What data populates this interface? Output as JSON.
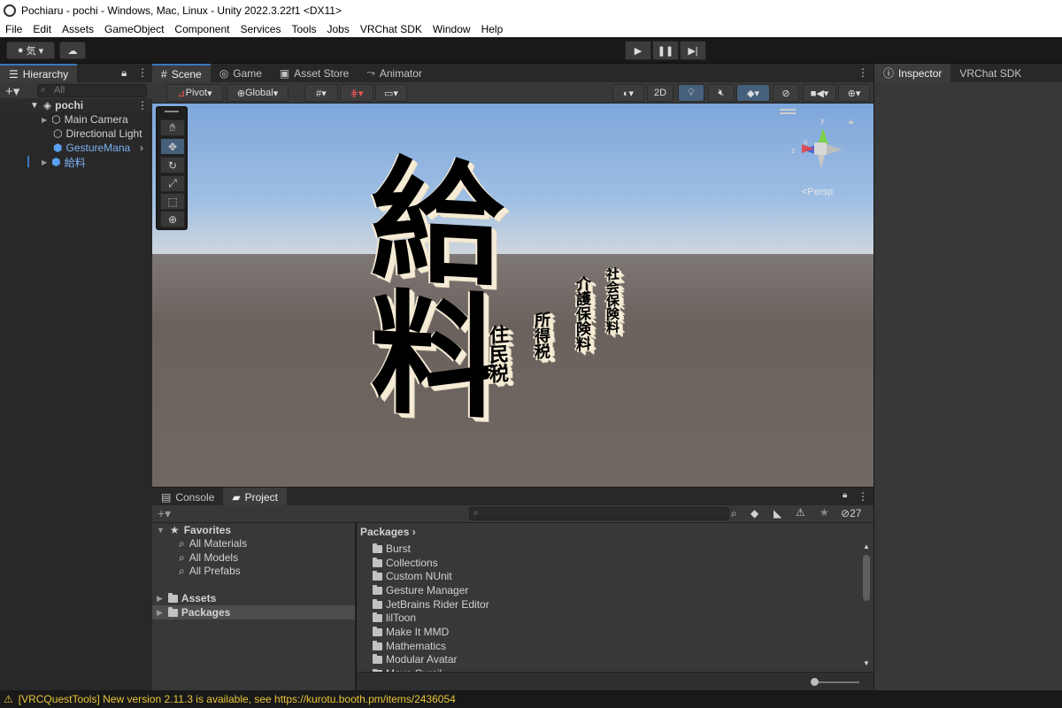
{
  "window": {
    "title": "Pochiaru - pochi - Windows, Mac, Linux - Unity 2022.3.22f1 <DX11>"
  },
  "menu": [
    "File",
    "Edit",
    "Assets",
    "GameObject",
    "Component",
    "Services",
    "Tools",
    "Jobs",
    "VRChat SDK",
    "Window",
    "Help"
  ],
  "toolbar": {
    "account_label": "気",
    "play": "▶",
    "pause": "❚❚",
    "step": "▶|"
  },
  "hierarchy": {
    "tab": "Hierarchy",
    "search_placeholder": "All",
    "scene": "pochi",
    "items": [
      {
        "label": "Main Camera",
        "color": "#d2d2d2"
      },
      {
        "label": "Directional Light",
        "color": "#d2d2d2"
      },
      {
        "label": "GestureMana",
        "color": "#7cb1f4"
      },
      {
        "label": "給料",
        "color": "#7cb1f4"
      }
    ]
  },
  "scene": {
    "tabs": [
      "Scene",
      "Game",
      "Asset Store",
      "Animator"
    ],
    "pivot": "Pivot",
    "global": "Global",
    "mode_2d": "2D",
    "persp": "<Persp",
    "gizmo_x": "x",
    "gizmo_y": "y",
    "gizmo_z": "z",
    "texts": {
      "big": "給料",
      "t1": "住民税",
      "t2": "所得税",
      "t3": "介護保険料",
      "t4": "社会保険料"
    }
  },
  "inspector": {
    "tabs": [
      "Inspector",
      "VRChat SDK"
    ]
  },
  "bottom": {
    "tabs": [
      "Console",
      "Project"
    ],
    "hidden_count": "27",
    "favorites": {
      "label": "Favorites",
      "items": [
        "All Materials",
        "All Models",
        "All Prefabs"
      ]
    },
    "roots": [
      "Assets",
      "Packages"
    ],
    "breadcrumb": "Packages",
    "packages": [
      "Burst",
      "Collections",
      "Custom NUnit",
      "Gesture Manager",
      "JetBrains Rider Editor",
      "lilToon",
      "Make It MMD",
      "Mathematics",
      "Modular Avatar",
      "Moyo Cursil"
    ]
  },
  "status": {
    "message": "[VRCQuestTools] New version 2.11.3 is available, see https://kurotu.booth.pm/items/2436054"
  },
  "colors": {
    "accent": "#3a79bb",
    "warning": "#e8c53a",
    "sky_top": "#8fb3e0",
    "ground": "#6f6761"
  }
}
